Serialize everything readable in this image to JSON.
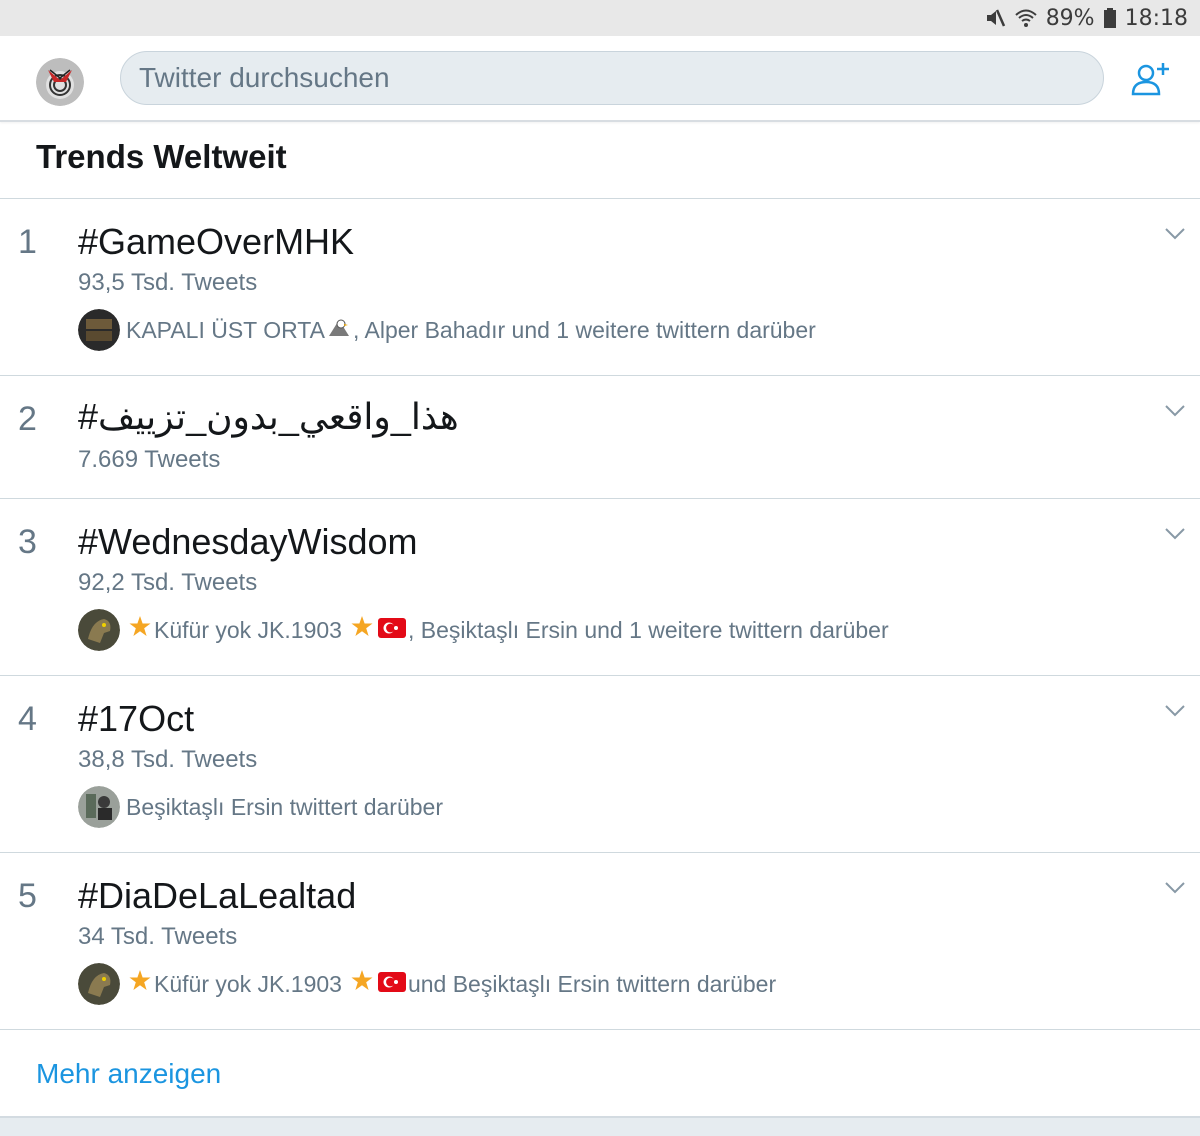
{
  "status_bar": {
    "battery": "89%",
    "time": "18:18",
    "icons": [
      "mute-icon",
      "wifi-icon",
      "battery-icon"
    ]
  },
  "header": {
    "search_placeholder": "Twitter durchsuchen",
    "icons": [
      "profile-avatar",
      "add-user-icon"
    ]
  },
  "section_title": "Trends Weltweit",
  "trends": [
    {
      "rank": "1",
      "tag": "#GameOverMHK",
      "count": "93,5 Tsd. Tweets",
      "context_a": "KAPALI ÜST ORTA",
      "context_b": ", Alper Bahadır und 1 weitere twittern darüber"
    },
    {
      "rank": "2",
      "tag": "#هذا_واقعي_بدون_تزييف",
      "count": "7.669 Tweets"
    },
    {
      "rank": "3",
      "tag": "#WednesdayWisdom",
      "count": "92,2 Tsd. Tweets",
      "context_a": "Küfür yok JK.1903",
      "context_b": ", Beşiktaşlı Ersin und 1 weitere twittern darüber"
    },
    {
      "rank": "4",
      "tag": "#17Oct",
      "count": "38,8 Tsd. Tweets",
      "context_a": "Beşiktaşlı Ersin twittert darüber"
    },
    {
      "rank": "5",
      "tag": "#DiaDeLaLealtad",
      "count": "34 Tsd. Tweets",
      "context_a": "Küfür yok JK.1903",
      "context_b": " und Beşiktaşlı Ersin twittern darüber"
    }
  ],
  "more_link": "Mehr anzeigen",
  "colors": {
    "accent": "#1b95e0",
    "secondary_text": "#657786",
    "divider": "#cfd9de",
    "search_bg": "#e6ecf0"
  }
}
